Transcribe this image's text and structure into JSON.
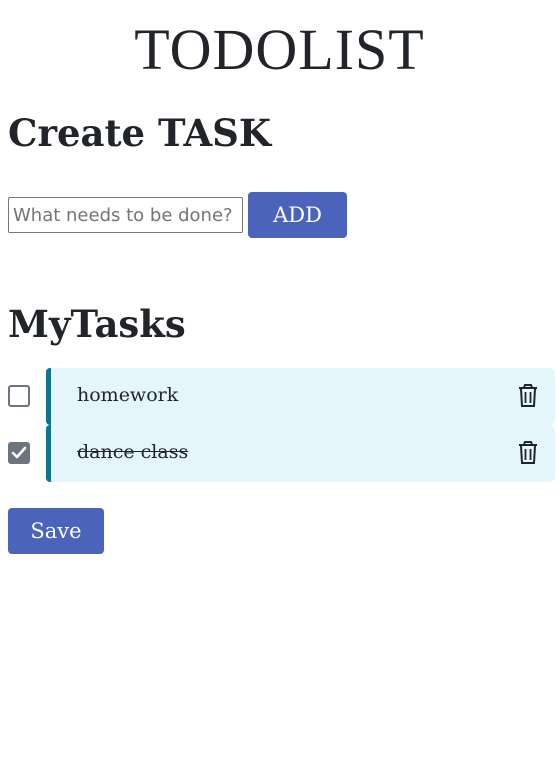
{
  "app": {
    "title": "TODOLIST"
  },
  "create": {
    "heading": "Create TASK",
    "input_value": "",
    "input_placeholder": "What needs to be done?",
    "add_label": "ADD"
  },
  "tasks": {
    "heading": "MyTasks",
    "items": [
      {
        "label": "homework",
        "done": false,
        "icon": "trash-icon"
      },
      {
        "label": "dance class",
        "done": true,
        "icon": "trash-icon"
      }
    ]
  },
  "footer": {
    "save_label": "Save"
  },
  "colors": {
    "primary_button": "#4c63bb",
    "task_background": "#e5f5fc",
    "task_accent": "#0e7490",
    "checkbox_checked": "#6c757d"
  }
}
